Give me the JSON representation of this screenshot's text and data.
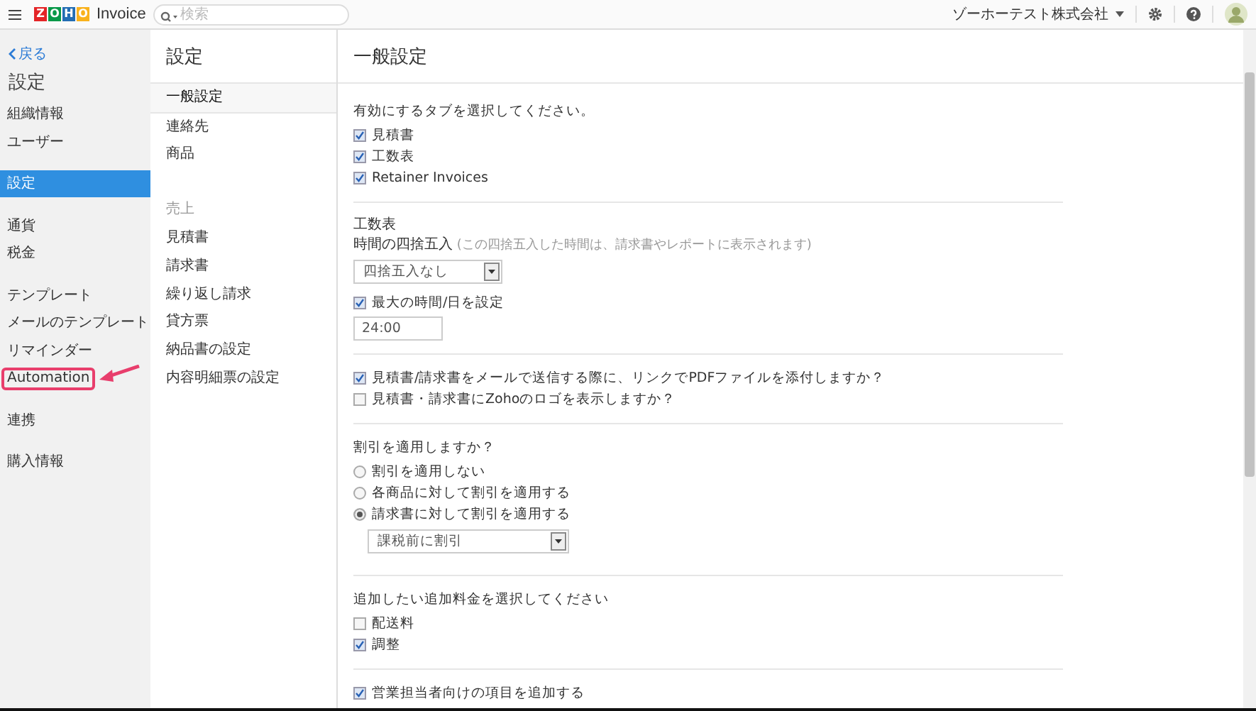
{
  "header": {
    "logo_letters": [
      {
        "text": "Z",
        "color": "#e42527"
      },
      {
        "text": "O",
        "color": "#089949"
      },
      {
        "text": "H",
        "color": "#226db4"
      },
      {
        "text": "O",
        "color": "#f9b21d"
      }
    ],
    "product": "Invoice",
    "search": {
      "placeholder": "検索"
    },
    "organization": "ゾーホーテスト株式会社"
  },
  "sidebar": {
    "back": "戻る",
    "title": "設定",
    "groups": [
      [
        {
          "label": "組織情報",
          "selected": false,
          "highlighted": false
        },
        {
          "label": "ユーザー",
          "selected": false,
          "highlighted": false
        }
      ],
      [
        {
          "label": "設定",
          "selected": true,
          "highlighted": false
        }
      ],
      [
        {
          "label": "通貨",
          "selected": false,
          "highlighted": false
        },
        {
          "label": "税金",
          "selected": false,
          "highlighted": false
        }
      ],
      [
        {
          "label": "テンプレート",
          "selected": false,
          "highlighted": false
        },
        {
          "label": "メールのテンプレート",
          "selected": false,
          "highlighted": false
        },
        {
          "label": "リマインダー",
          "selected": false,
          "highlighted": false
        },
        {
          "label": "Automation",
          "selected": false,
          "highlighted": true
        }
      ],
      [
        {
          "label": "連携",
          "selected": false,
          "highlighted": false
        }
      ],
      [
        {
          "label": "購入情報",
          "selected": false,
          "highlighted": false
        }
      ]
    ]
  },
  "subnav": {
    "title": "設定",
    "items": [
      {
        "kind": "link",
        "label": "一般設定",
        "selected": true
      },
      {
        "kind": "link",
        "label": "連絡先",
        "selected": false
      },
      {
        "kind": "link",
        "label": "商品",
        "selected": false
      },
      {
        "kind": "header",
        "label": "売上"
      },
      {
        "kind": "link",
        "label": "見積書",
        "selected": false
      },
      {
        "kind": "link",
        "label": "請求書",
        "selected": false
      },
      {
        "kind": "link",
        "label": "繰り返し請求",
        "selected": false
      },
      {
        "kind": "link",
        "label": "貸方票",
        "selected": false
      },
      {
        "kind": "link",
        "label": "納品書の設定",
        "selected": false
      },
      {
        "kind": "link",
        "label": "内容明細票の設定",
        "selected": false
      }
    ]
  },
  "main": {
    "title": "一般設定",
    "sections": [
      [
        {
          "kind": "label",
          "text": "有効にするタブを選択してください。"
        },
        {
          "kind": "checkbox",
          "text": "見積書",
          "checked": true
        },
        {
          "kind": "checkbox",
          "text": "工数表",
          "checked": true
        },
        {
          "kind": "checkbox",
          "text": "Retainer Invoices",
          "checked": true
        }
      ],
      [
        {
          "kind": "heading",
          "text": "工数表"
        },
        {
          "kind": "note",
          "text": "**時間の四捨五入** (この四捨五入した時間は、請求書やレポートに表示されます)"
        },
        {
          "kind": "select",
          "text": "四捨五入なし"
        },
        {
          "kind": "checkbox",
          "text": "最大の時間/日を設定",
          "checked": true
        },
        {
          "kind": "input",
          "text": "24:00"
        }
      ],
      [
        {
          "kind": "checkbox",
          "text": "見積書/請求書をメールで送信する際に、リンクでPDFファイルを添付しますか？",
          "checked": true
        },
        {
          "kind": "checkbox",
          "text": "見積書・請求書にZohoのロゴを表示しますか？",
          "checked": false
        }
      ],
      [
        {
          "kind": "label",
          "text": "割引を適用しますか？"
        },
        {
          "kind": "radio",
          "text": "割引を適用しない",
          "selected": false
        },
        {
          "kind": "radio",
          "text": "各商品に対して割引を適用する",
          "selected": false
        },
        {
          "kind": "radio",
          "text": "請求書に対して割引を適用する",
          "selected": true
        },
        {
          "kind": "select",
          "text": "課税前に割引",
          "indented": true
        }
      ],
      [
        {
          "kind": "label",
          "text": "追加したい追加料金を選択してください"
        },
        {
          "kind": "checkbox",
          "text": "配送料",
          "checked": false
        },
        {
          "kind": "checkbox",
          "text": "調整",
          "checked": true
        }
      ],
      [
        {
          "kind": "checkbox",
          "text": "営業担当者向けの項目を追加する",
          "checked": true
        }
      ]
    ]
  }
}
